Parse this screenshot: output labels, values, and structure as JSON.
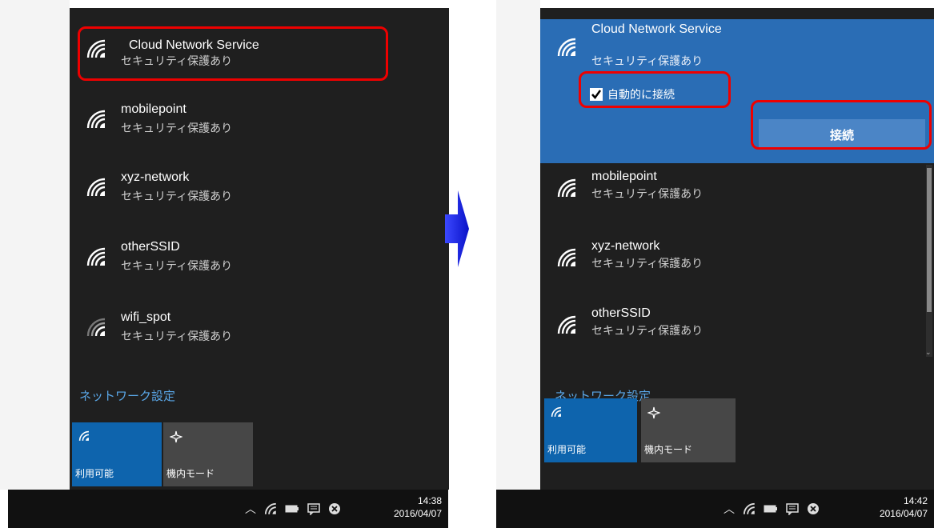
{
  "left": {
    "networks": [
      {
        "ssid": "Cloud Network Service",
        "security": "セキュリティ保護あり"
      },
      {
        "ssid": "mobilepoint",
        "security": "セキュリティ保護あり"
      },
      {
        "ssid": "xyz-network",
        "security": "セキュリティ保護あり"
      },
      {
        "ssid": "otherSSID",
        "security": "セキュリティ保護あり"
      },
      {
        "ssid": "wifi_spot",
        "security": "セキュリティ保護あり"
      }
    ],
    "network_settings": "ネットワーク設定",
    "tiles": {
      "wifi": "利用可能",
      "airplane": "機内モード"
    },
    "clock": {
      "time": "14:38",
      "date": "2016/04/07"
    }
  },
  "right": {
    "selected": {
      "ssid": "Cloud Network Service",
      "security": "セキュリティ保護あり",
      "auto_connect": "自動的に接続",
      "connect_button": "接続"
    },
    "networks": [
      {
        "ssid": "mobilepoint",
        "security": "セキュリティ保護あり"
      },
      {
        "ssid": "xyz-network",
        "security": "セキュリティ保護あり"
      },
      {
        "ssid": "otherSSID",
        "security": "セキュリティ保護あり"
      }
    ],
    "network_settings": "ネットワーク設定",
    "tiles": {
      "wifi": "利用可能",
      "airplane": "機内モード"
    },
    "clock": {
      "time": "14:42",
      "date": "2016/04/07"
    }
  },
  "colors": {
    "accent": "#0e64ad",
    "selected_bg": "#2a6db5",
    "highlight": "#e00000",
    "arrow": "#1a22e0"
  },
  "icons": [
    "wifi-icon",
    "airplane-icon",
    "chevron-up-icon",
    "battery-icon",
    "notification-icon",
    "close-circle-icon"
  ]
}
